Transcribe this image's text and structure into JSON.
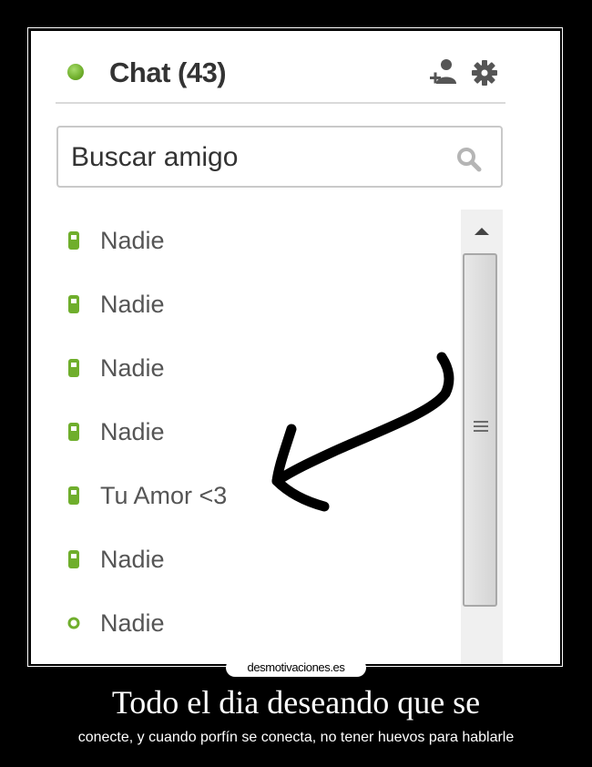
{
  "chat": {
    "title": "Chat (43)",
    "status_color": "#6fae2c",
    "icons": [
      "add-friend-icon",
      "gear-icon"
    ]
  },
  "search": {
    "placeholder": "Buscar amigo",
    "icon": "search-icon"
  },
  "friends": [
    {
      "name": "Nadie",
      "icon": "mobile-icon"
    },
    {
      "name": "Nadie",
      "icon": "mobile-icon"
    },
    {
      "name": "Nadie",
      "icon": "mobile-icon"
    },
    {
      "name": "Nadie",
      "icon": "mobile-icon"
    },
    {
      "name": "Tu Amor <3",
      "icon": "mobile-icon"
    },
    {
      "name": "Nadie",
      "icon": "mobile-icon"
    },
    {
      "name": "Nadie",
      "icon": "online-dot-icon"
    }
  ],
  "watermark": "desmotivaciones.es",
  "caption": {
    "main": "Todo el dia deseando que se",
    "sub": "conecte, y cuando porfín se conecta, no tener huevos para hablarle"
  },
  "colors": {
    "accent_green": "#6fae2c",
    "background": "#000000"
  }
}
